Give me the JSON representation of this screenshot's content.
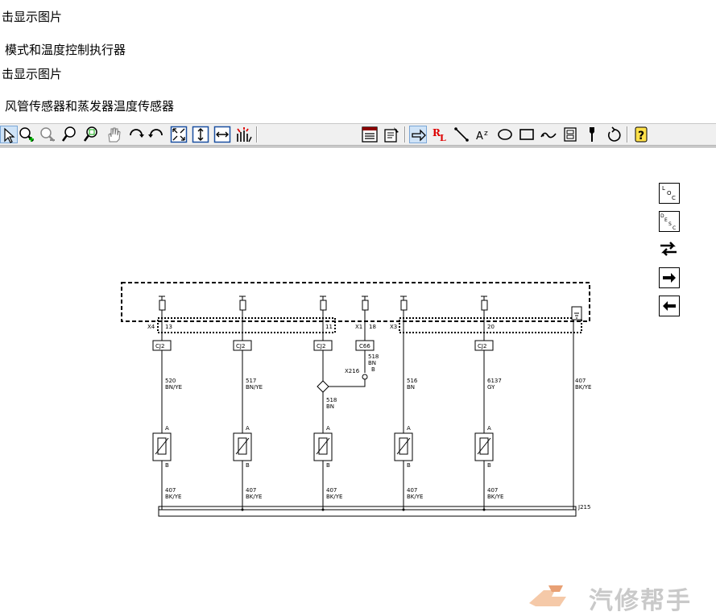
{
  "header_lines": [
    "击显示图片",
    "模式和温度控制执行器",
    "击显示图片",
    "风管传感器和蒸发器温度传感器"
  ],
  "toolbar": {
    "left_tools": [
      "select-arrow-icon",
      "zoom-in-icon",
      "zoom-out-icon",
      "zoom-icon",
      "zoom-area-icon",
      "pan-hand-icon",
      "rotate-cw-icon",
      "rotate-ccw-icon",
      "fit-page-icon",
      "fit-height-icon",
      "fit-width-icon",
      "highlight-icon"
    ],
    "right_tools": [
      "list-icon",
      "properties-icon",
      "arrow-tool-icon",
      "rl-label-icon",
      "line-tool-icon",
      "text-tool-icon",
      "loop-tool-icon",
      "rect-tool-icon",
      "wave-tool-icon",
      "component-tool-icon",
      "probe-tool-icon",
      "undo-icon",
      "help-icon"
    ],
    "rl_label": "RL",
    "az_label": "Az"
  },
  "side_buttons": {
    "loc": "LOC",
    "desc": "DESC"
  },
  "diagram": {
    "connectors_top": [
      "X4",
      "13",
      "X1",
      "18",
      "X3"
    ],
    "clips": [
      "CJ2",
      "CJ2",
      "CJ2",
      "C66",
      "CJ2"
    ],
    "wires": [
      {
        "circuit": "520",
        "color": "BN/YE"
      },
      {
        "circuit": "517",
        "color": "BN/YE"
      },
      {
        "circuit": "518",
        "color": "BN"
      },
      {
        "circuit": "516",
        "color": "BN"
      },
      {
        "circuit": "6137",
        "color": "GY"
      },
      {
        "circuit": "407",
        "color": "BK/YE"
      }
    ],
    "splice_label": "X216",
    "splice_wire": {
      "circuit": "518",
      "color": "BN",
      "pin": "B"
    },
    "ground_wires": [
      "407",
      "407",
      "407",
      "407",
      "407"
    ],
    "ground_color": "BK/YE",
    "ground_bar": "J215",
    "pin_a": "A",
    "pin_b": "B",
    "pin_numbers": [
      "11",
      "20"
    ]
  },
  "watermark": {
    "text": "汽修帮手"
  }
}
